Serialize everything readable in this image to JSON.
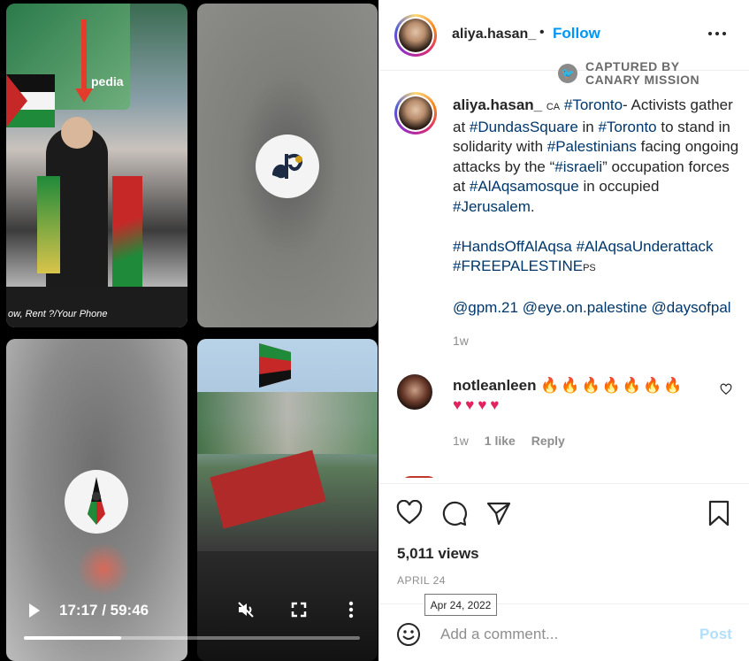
{
  "video": {
    "time_label": "17:17 / 59:46",
    "progress": 0.29,
    "tile1": {
      "billboard_text": "pedia",
      "stage_text": "ow, Rent ?/Your Phone"
    },
    "icons": [
      "play-icon",
      "mute-icon",
      "fullscreen-icon",
      "more-vertical-icon"
    ]
  },
  "header": {
    "username": "aliya.hasan_",
    "separator": "•",
    "follow_label": "Follow",
    "watermark_line1": "CAPTURED BY",
    "watermark_line2": "CANARY MISSION"
  },
  "caption": {
    "username": "aliya.hasan_",
    "region": "CA",
    "t1": "#Toronto",
    "t2": "- Activists gather at ",
    "t3": "#DundasSquare",
    "t4": " in ",
    "t5": "#Toronto",
    "t6": " to stand in solidarity with ",
    "t7": "#Palestinians",
    "t8": " facing ongoing attacks by the “",
    "t9": "#israeli",
    "t10": "” occupation forces at ",
    "t11": "#AlAqsamosque",
    "t12": " in occupied ",
    "t13": "#Jerusalem",
    "t14": ".",
    "h1": "#HandsOffAlAqsa",
    "h2": "#AlAqsaUnderattack",
    "h3": "#FREEPALESTINE",
    "h3_suffix": "PS",
    "m1": "@gpm.21",
    "m2": "@eye.on.palestine",
    "m3": "@daysofpal",
    "age": "1w"
  },
  "comment": {
    "username": "notleanleen",
    "flames": "🔥🔥🔥🔥🔥🔥🔥",
    "hearts": "♥♥♥♥",
    "age": "1w",
    "likes": "1 like",
    "reply": "Reply"
  },
  "post": {
    "views": "5,011 views",
    "date": "APRIL 24",
    "tooltip": "Apr 24, 2022"
  },
  "comment_bar": {
    "placeholder": "Add a comment...",
    "post_label": "Post"
  }
}
